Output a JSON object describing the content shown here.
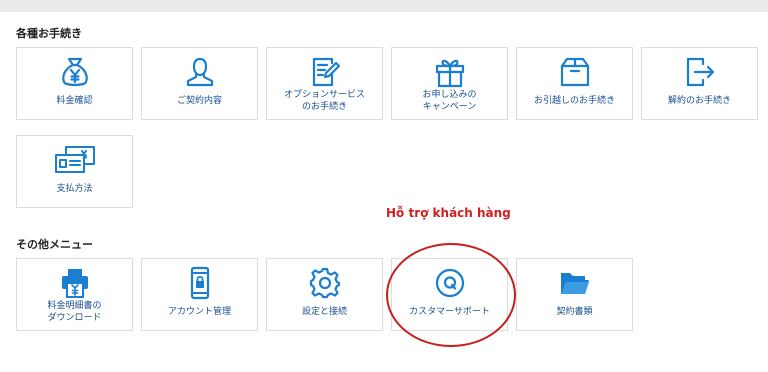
{
  "sections": {
    "procedures_title": "各種お手続き",
    "other_title": "その他メニュー"
  },
  "procedures": [
    {
      "lines": [
        "料金確認"
      ],
      "icon": "money-bag-icon"
    },
    {
      "lines": [
        "ご契約内容"
      ],
      "icon": "user-icon"
    },
    {
      "lines": [
        "オプションサービス",
        "のお手続き"
      ],
      "icon": "edit-document-icon"
    },
    {
      "lines": [
        "お申し込みの",
        "キャンペーン"
      ],
      "icon": "gift-icon"
    },
    {
      "lines": [
        "お引越しのお手続き"
      ],
      "icon": "moving-box-icon"
    },
    {
      "lines": [
        "解約のお手続き"
      ],
      "icon": "exit-icon"
    },
    {
      "lines": [
        "支払方法"
      ],
      "icon": "payment-cards-icon"
    }
  ],
  "others": [
    {
      "lines": [
        "料金明細書の",
        "ダウンロード"
      ],
      "icon": "printer-icon"
    },
    {
      "lines": [
        "アカウント管理"
      ],
      "icon": "smartphone-lock-icon"
    },
    {
      "lines": [
        "設定と接続"
      ],
      "icon": "gear-icon"
    },
    {
      "lines": [
        "カスタマーサポート"
      ],
      "icon": "support-q-icon"
    },
    {
      "lines": [
        "契約書類"
      ],
      "icon": "folder-icon"
    }
  ],
  "annotation": "Hỗ trợ khách hàng",
  "colors": {
    "icon": "#1a7fd1",
    "label": "#1a4f8c",
    "annotation": "#d21f1f",
    "topbar": "#ebebeb"
  }
}
